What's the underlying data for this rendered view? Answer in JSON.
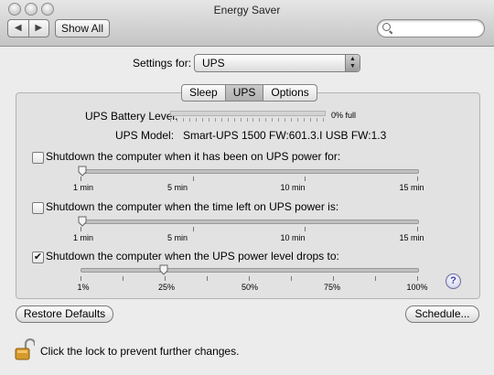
{
  "window": {
    "title": "Energy Saver"
  },
  "toolbar": {
    "show_all": "Show All",
    "back_icon": "back-arrow-icon",
    "forward_icon": "forward-arrow-icon",
    "search_placeholder": ""
  },
  "settings_for": {
    "label": "Settings for:",
    "value": "UPS"
  },
  "tabs": [
    {
      "label": "Sleep"
    },
    {
      "label": "UPS",
      "selected": true
    },
    {
      "label": "Options"
    }
  ],
  "ups": {
    "battery_label": "UPS Battery Level:",
    "battery_value": "0% full",
    "battery_percent": 0,
    "model_label": "UPS Model:",
    "model_value": "Smart-UPS 1500 FW:601.3.I USB FW:1.3"
  },
  "options": [
    {
      "label": "Shutdown the computer when it has been on UPS power for:",
      "checked": false,
      "tick_labels": [
        "1 min",
        "5 min",
        "10 min",
        "15 min"
      ],
      "value": "1 min"
    },
    {
      "label": "Shutdown the computer when the time left on UPS power is:",
      "checked": false,
      "tick_labels": [
        "1 min",
        "5 min",
        "10 min",
        "15 min"
      ],
      "value": "1 min"
    },
    {
      "label": "Shutdown the computer when the UPS power level drops to:",
      "checked": true,
      "tick_labels": [
        "1%",
        "25%",
        "50%",
        "75%",
        "100%"
      ],
      "value": "25%"
    }
  ],
  "buttons": {
    "restore": "Restore Defaults",
    "schedule": "Schedule...",
    "help": "?"
  },
  "lock": {
    "text": "Click the lock to prevent further changes.",
    "icon": "open-lock-icon"
  },
  "colors": {
    "accent": "#3b3bb0",
    "window_bg": "#ececec"
  }
}
